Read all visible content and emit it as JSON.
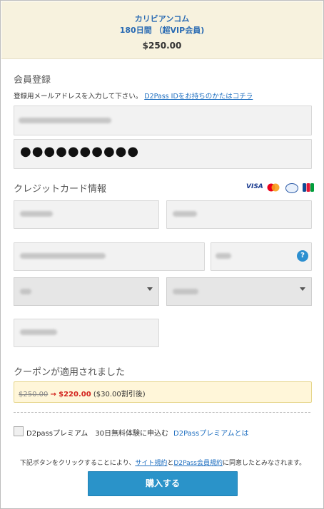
{
  "product": {
    "name": "カリビアンコム",
    "plan": "180日間 （超VIP会員)",
    "price": "$250.00"
  },
  "signup": {
    "title": "会員登録",
    "help_prefix": "登録用メールアドレスを入力して下さい。",
    "help_link": "D2Pass IDをお持ちのかたはコチラ",
    "password_mask": "●●●●●●●●●●"
  },
  "credit": {
    "title": "クレジットカード情報",
    "help_icon_text": "?",
    "brands": [
      "visa",
      "mastercard",
      "diners",
      "jcb"
    ],
    "visa_label": "VISA"
  },
  "coupon": {
    "title": "クーポンが適用されました",
    "old_price": "$250.00",
    "arrow": "→",
    "new_price": "$220.00",
    "discount": "($30.00割引後)"
  },
  "premium": {
    "checkbox_label": "D2passプレミアム　30日無料体験に申込む",
    "link": "D2Passプレミアムとは"
  },
  "legal": {
    "prefix": "下記ボタンをクリックすることにより、",
    "site_terms": "サイト規約",
    "and": "と",
    "d2pass_terms": "D2Pass会員規約",
    "suffix": "に同意したとみなされます。"
  },
  "buy": {
    "label": "購入する"
  },
  "colors": {
    "accent": "#2a93c9",
    "link": "#1f6fc0",
    "price_red": "#d3241e",
    "top_band": "#f7f2de",
    "coupon_band": "#fff6d9"
  }
}
